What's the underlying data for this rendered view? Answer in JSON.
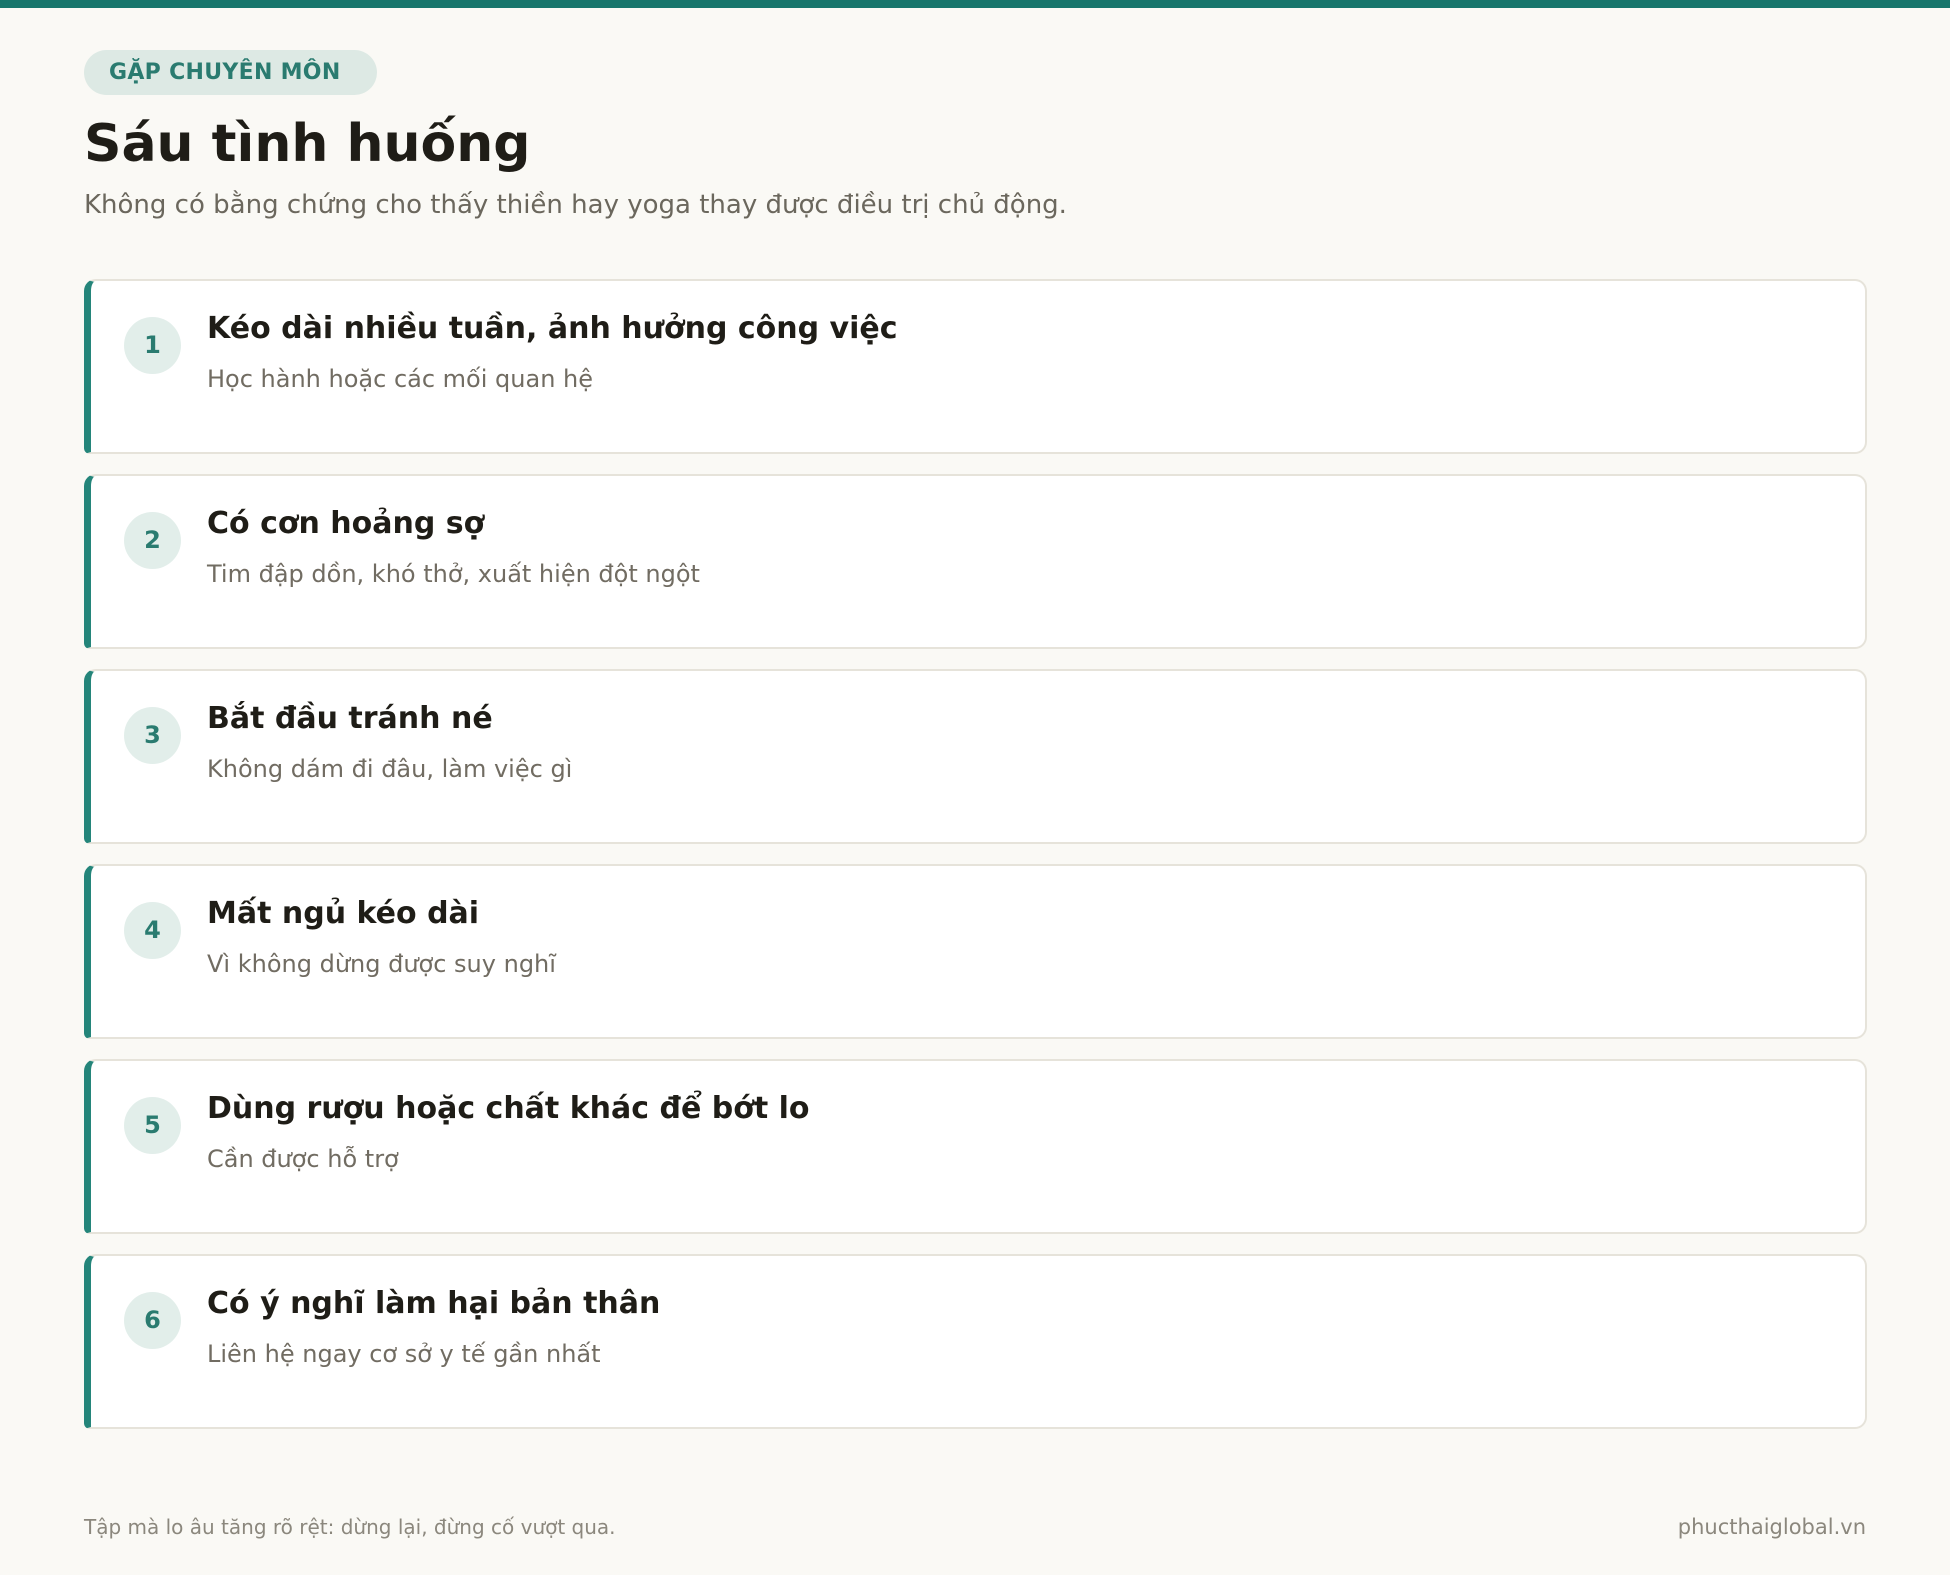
{
  "header": {
    "eyebrow": "GẶP CHUYÊN MÔN",
    "title": "Sáu tình huống",
    "subtitle": "Không có bằng chứng cho thấy thiền hay yoga thay được điều trị chủ động."
  },
  "items": [
    {
      "number": "1",
      "title": "Kéo dài nhiều tuần, ảnh hưởng công việc",
      "desc": "Học hành hoặc các mối quan hệ"
    },
    {
      "number": "2",
      "title": "Có cơn hoảng sợ",
      "desc": "Tim đập dồn, khó thở, xuất hiện đột ngột"
    },
    {
      "number": "3",
      "title": "Bắt đầu tránh né",
      "desc": "Không dám đi đâu, làm việc gì"
    },
    {
      "number": "4",
      "title": "Mất ngủ kéo dài",
      "desc": "Vì không dừng được suy nghĩ"
    },
    {
      "number": "5",
      "title": "Dùng rượu hoặc chất khác để bớt lo",
      "desc": "Cần được hỗ trợ"
    },
    {
      "number": "6",
      "title": "Có ý nghĩ làm hại bản thân",
      "desc": "Liên hệ ngay cơ sở y tế gần nhất"
    }
  ],
  "footer": {
    "note": "Tập mà lo âu tăng rõ rệt: dừng lại, đừng cố vượt qua.",
    "site": "phucthaiglobal.vn"
  },
  "colors": {
    "accent": "#17766c",
    "background": "#faf9f5",
    "badge_bg": "#dde9e4"
  }
}
